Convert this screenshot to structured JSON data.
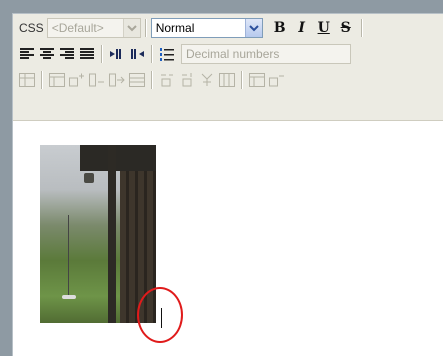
{
  "toolbar": {
    "css_label": "CSS",
    "css_select": {
      "value": "<Default>"
    },
    "format_select": {
      "value": "Normal"
    },
    "bold_label": "B",
    "italic_label": "I",
    "underline_label": "U",
    "strike_label": "S",
    "list_select": {
      "value": "Decimal numbers"
    }
  },
  "icons": {
    "align": [
      "align-left-icon",
      "align-center-icon",
      "align-right-icon",
      "align-justify-icon"
    ],
    "direction": [
      "ltr-icon",
      "rtl-icon"
    ],
    "list": "ordered-list-icon"
  },
  "colors": {
    "annotation": "#e01b1b",
    "toolbar_bg": "#ecebe3",
    "frame": "#8e9aa3"
  }
}
